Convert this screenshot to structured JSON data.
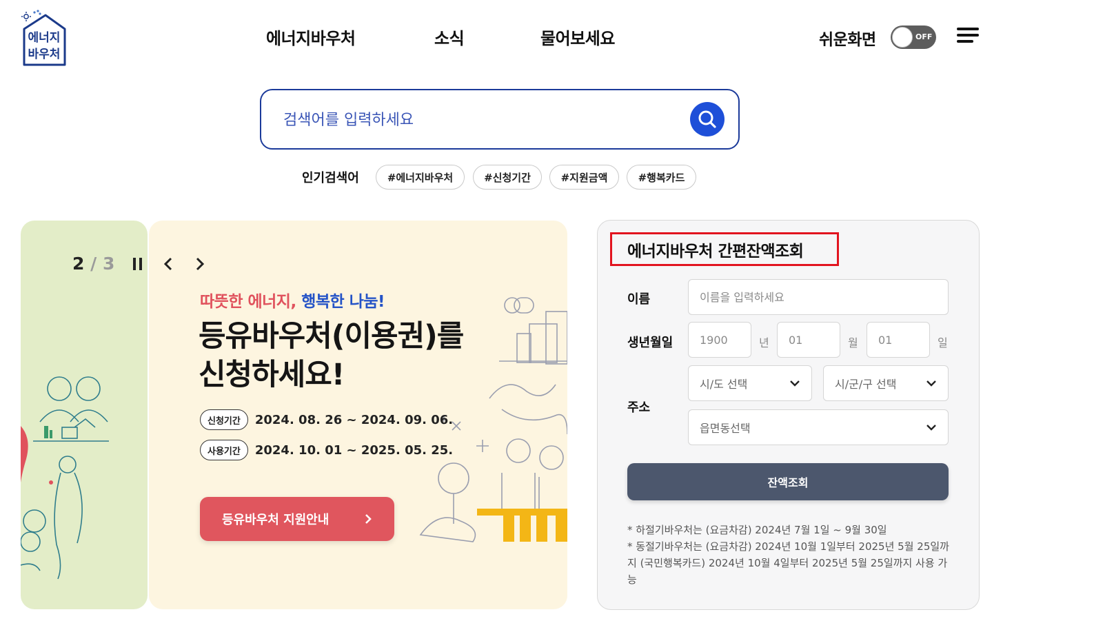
{
  "header": {
    "logo": {
      "line1": "에너지",
      "line2": "바우처"
    },
    "nav": [
      "에너지바우처",
      "소식",
      "물어보세요"
    ],
    "easy_mode": {
      "label": "쉬운화면",
      "toggle_state": "OFF"
    }
  },
  "search": {
    "placeholder": "검색어를 입력하세요",
    "popular_label": "인기검색어",
    "popular_tags": [
      "#에너지바우처",
      "#신청기간",
      "#지원금액",
      "#행복카드"
    ]
  },
  "banner": {
    "current": "2",
    "separator": "/",
    "total": "3",
    "tagline_red": "따뜻한 에너지,",
    "tagline_blue": "행복한 나눔!",
    "headline_line1": "등유바우처(이용권)를",
    "headline_line2": "신청하세요!",
    "periods": [
      {
        "badge": "신청기간",
        "text": "2024. 08. 26 ~ 2024. 09. 06."
      },
      {
        "badge": "사용기간",
        "text": "2024. 10. 01 ~ 2025. 05. 25."
      }
    ],
    "cta_label": "등유바우처 지원안내"
  },
  "balance": {
    "title": "에너지바우처 간편잔액조회",
    "name_label": "이름",
    "name_placeholder": "이름을 입력하세요",
    "birth_label": "생년월일",
    "birth_year_placeholder": "1900",
    "birth_year_unit": "년",
    "birth_month_placeholder": "01",
    "birth_month_unit": "월",
    "birth_day_placeholder": "01",
    "birth_day_unit": "일",
    "address_label": "주소",
    "sido_select": "시/도 선택",
    "sigungu_select": "시/군/구 선택",
    "eupmyeondong_select": "읍면동선택",
    "submit_label": "잔액조회",
    "notes": [
      "* 하절기바우처는 (요금차감) 2024년 7월 1일 ~ 9월 30일",
      "* 동절기바우처는 (요금차감) 2024년 10월 1일부터 2025년 5월 25일까지 (국민행복카드) 2024년 10월 4일부터 2025년 5월 25일까지 사용 가능"
    ]
  },
  "colors": {
    "accent_blue": "#1e4fd8",
    "cta_red": "#e0565e",
    "highlight_box": "#e2141f",
    "submit_bg": "#4c576d",
    "banner_green": "#e3edc8",
    "banner_cream": "#fdf5e0"
  }
}
